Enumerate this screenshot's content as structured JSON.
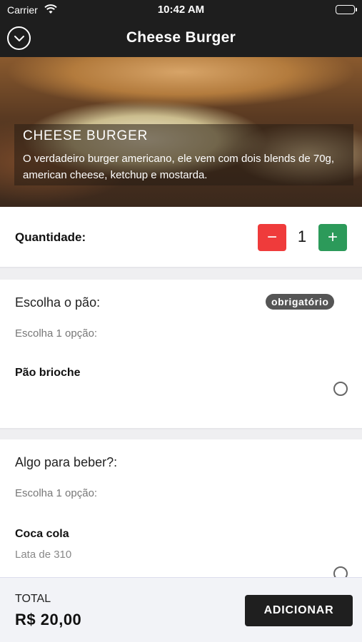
{
  "status_bar": {
    "carrier": "Carrier",
    "time": "10:42 AM"
  },
  "nav": {
    "title": "Cheese Burger",
    "back_icon": "chevron-down-circle-icon"
  },
  "product": {
    "name": "CHEESE BURGER",
    "description": "O verdadeiro burger americano, ele vem com dois blends de 70g, american cheese, ketchup e mostarda."
  },
  "quantity": {
    "label": "Quantidade:",
    "value": "1",
    "minus": "−",
    "plus": "+"
  },
  "sections": [
    {
      "title": "Escolha o pão:",
      "badge": "obrigatório",
      "hint": "Escolha 1 opção:",
      "options": [
        {
          "name": "Pão brioche"
        }
      ]
    },
    {
      "title": "Algo para beber?:",
      "hint": "Escolha 1 opção:",
      "options": [
        {
          "name": "Coca cola",
          "desc": "Lata de 310"
        }
      ]
    }
  ],
  "footer": {
    "total_label": "TOTAL",
    "total_value": "R$ 20,00",
    "button": "ADICIONAR"
  },
  "colors": {
    "minus": "#ef3b3b",
    "plus": "#2c9a5a",
    "dark": "#1e1e1e"
  }
}
